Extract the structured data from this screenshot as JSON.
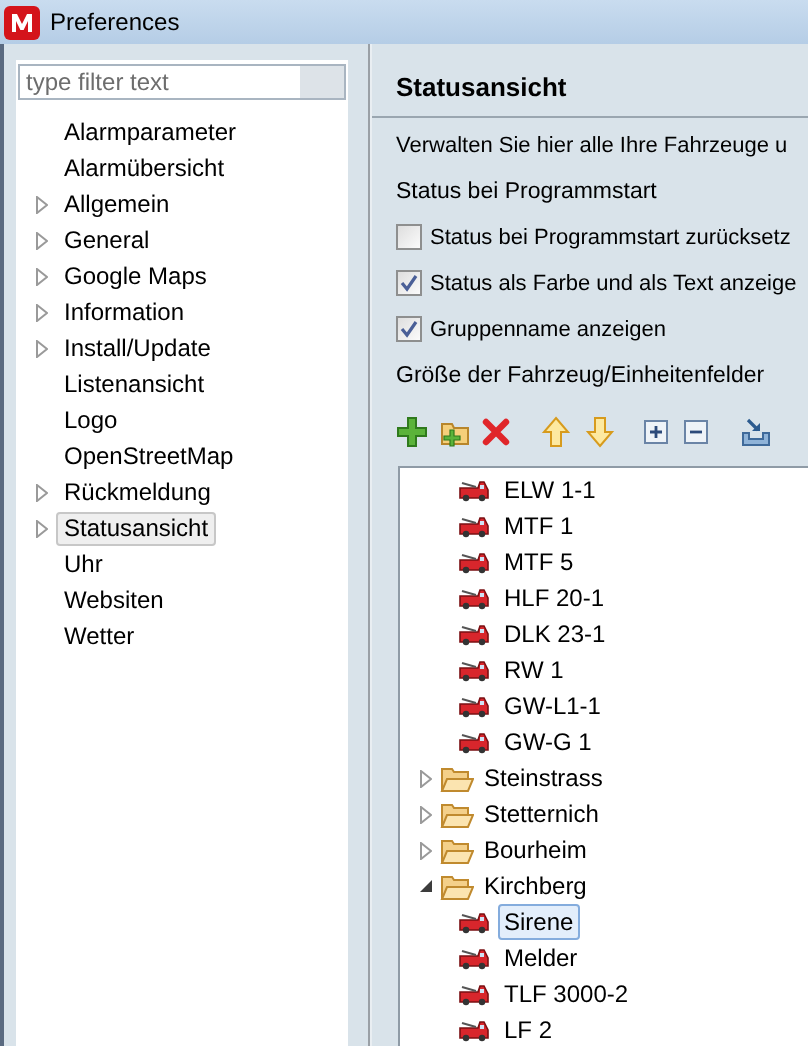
{
  "window": {
    "title": "Preferences"
  },
  "sidebar": {
    "filter": {
      "placeholder": "type filter text"
    },
    "items": [
      {
        "label": "Alarmparameter",
        "has_children": false,
        "selected": false
      },
      {
        "label": "Alarmübersicht",
        "has_children": false,
        "selected": false
      },
      {
        "label": "Allgemein",
        "has_children": true,
        "selected": false
      },
      {
        "label": "General",
        "has_children": true,
        "selected": false
      },
      {
        "label": "Google Maps",
        "has_children": true,
        "selected": false
      },
      {
        "label": "Information",
        "has_children": true,
        "selected": false
      },
      {
        "label": "Install/Update",
        "has_children": true,
        "selected": false
      },
      {
        "label": "Listenansicht",
        "has_children": false,
        "selected": false
      },
      {
        "label": "Logo",
        "has_children": false,
        "selected": false
      },
      {
        "label": "OpenStreetMap",
        "has_children": false,
        "selected": false
      },
      {
        "label": "Rückmeldung",
        "has_children": true,
        "selected": false
      },
      {
        "label": "Statusansicht",
        "has_children": true,
        "selected": true
      },
      {
        "label": "Uhr",
        "has_children": false,
        "selected": false
      },
      {
        "label": "Websiten",
        "has_children": false,
        "selected": false
      },
      {
        "label": "Wetter",
        "has_children": false,
        "selected": false
      }
    ]
  },
  "page": {
    "title": "Statusansicht",
    "description": "Verwalten Sie hier alle Ihre Fahrzeuge u",
    "section_label": "Status bei Programmstart",
    "options": [
      {
        "label": "Status bei Programmstart zurücksetz",
        "checked": false
      },
      {
        "label": "Status als Farbe und als Text anzeige",
        "checked": true
      },
      {
        "label": "Gruppenname anzeigen",
        "checked": true
      }
    ],
    "size_label": "Größe der Fahrzeug/Einheitenfelder",
    "tree": {
      "continued_items": [
        {
          "label": "ELW 1-1",
          "selected": false
        },
        {
          "label": "MTF 1",
          "selected": false
        },
        {
          "label": "MTF 5",
          "selected": false
        },
        {
          "label": "HLF 20-1",
          "selected": false
        },
        {
          "label": "DLK 23-1",
          "selected": false
        },
        {
          "label": "RW 1",
          "selected": false
        },
        {
          "label": "GW-L1-1",
          "selected": false
        },
        {
          "label": "GW-G 1",
          "selected": false
        }
      ],
      "groups": [
        {
          "label": "Steinstrass",
          "expanded": false
        },
        {
          "label": "Stetternich",
          "expanded": false
        },
        {
          "label": "Bourheim",
          "expanded": false
        },
        {
          "label": "Kirchberg",
          "expanded": true,
          "children": [
            {
              "label": "Sirene",
              "selected": true
            },
            {
              "label": "Melder",
              "selected": false
            },
            {
              "label": "TLF 3000-2",
              "selected": false
            },
            {
              "label": "LF 2",
              "selected": false
            }
          ]
        }
      ]
    }
  }
}
